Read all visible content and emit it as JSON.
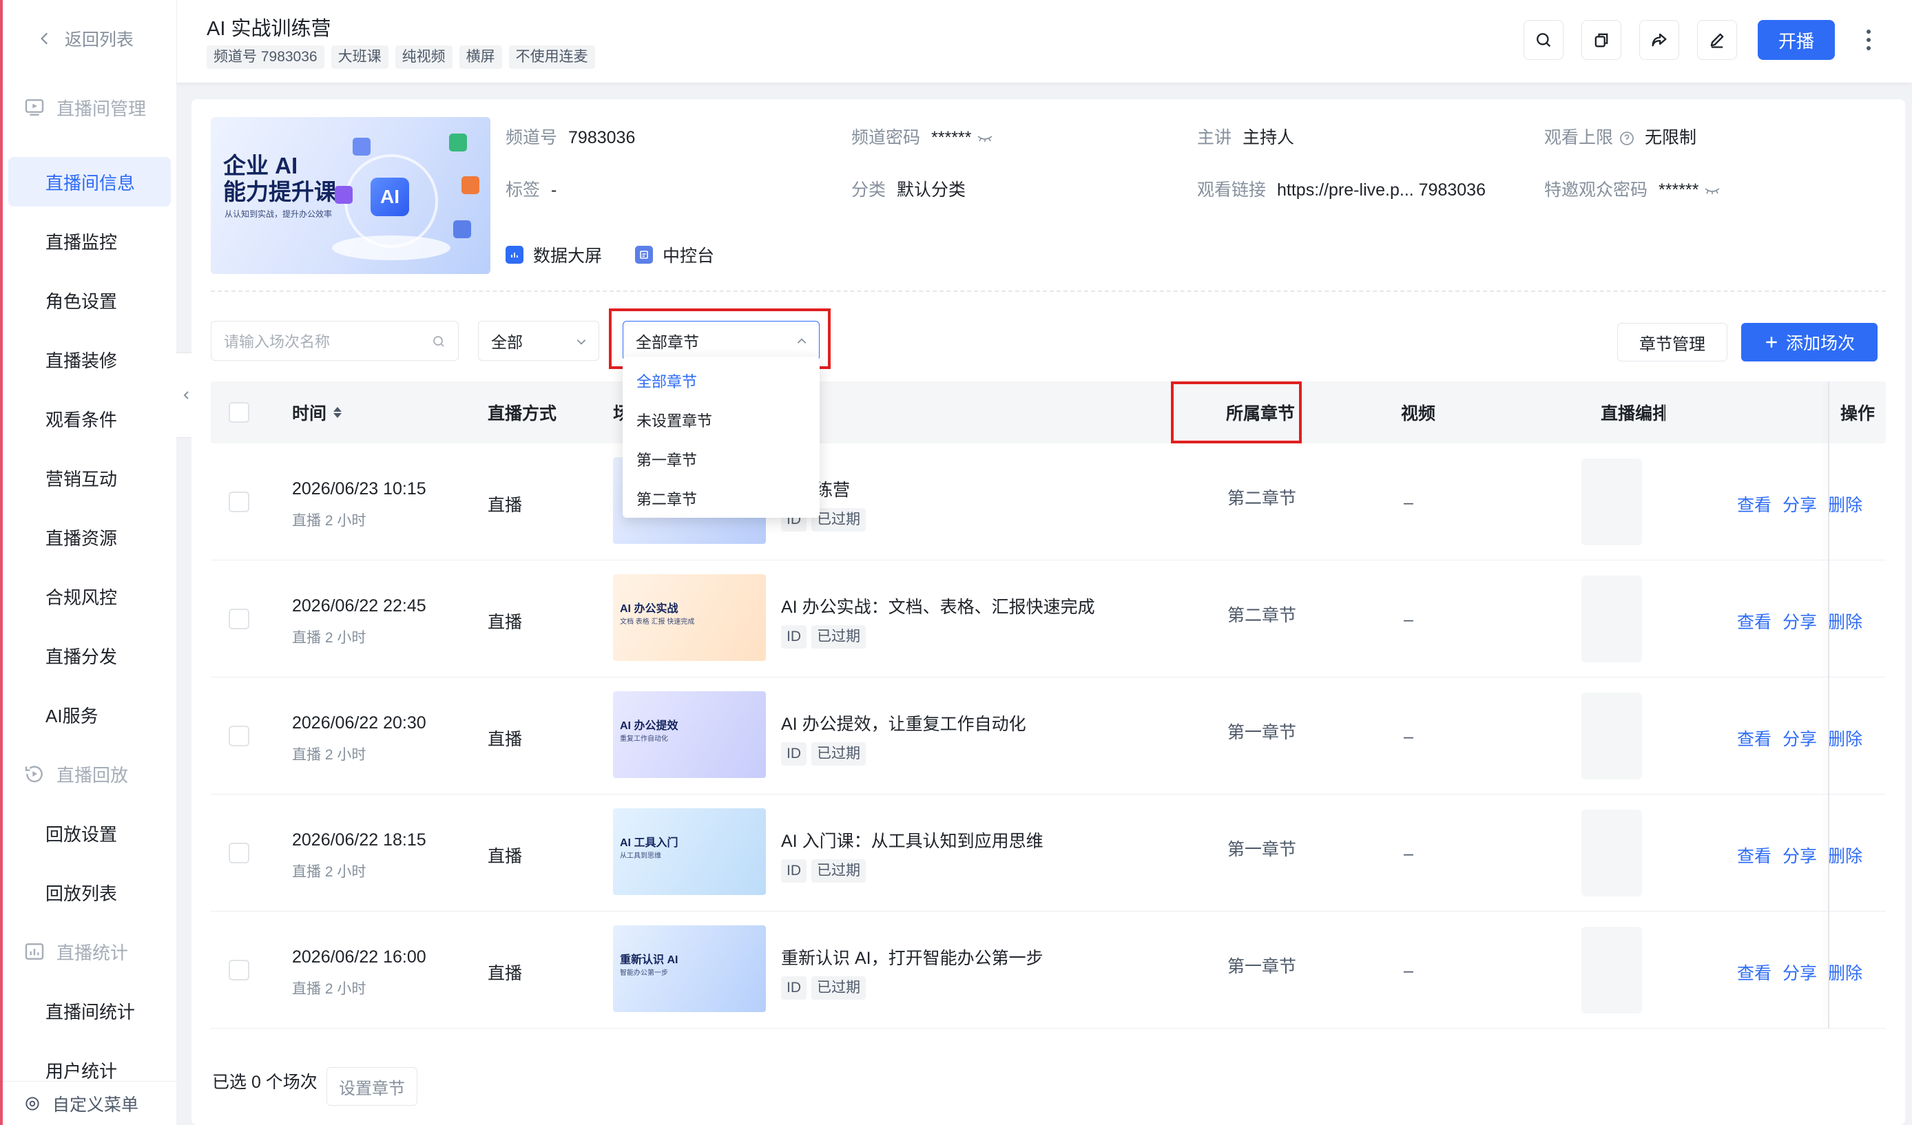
{
  "topbar": {
    "back_label": "返回列表",
    "title": "AI 实战训练营",
    "tags": [
      "频道号 7983036",
      "大班课",
      "纯视频",
      "横屏",
      "不使用连麦"
    ],
    "live_button": "开播"
  },
  "sidebar": {
    "groups": [
      {
        "label": "直播间管理",
        "icon": "screen-play-icon",
        "items": [
          "直播间信息",
          "直播监控",
          "角色设置",
          "直播装修",
          "观看条件",
          "营销互动",
          "直播资源",
          "合规风控",
          "直播分发",
          "AI服务"
        ]
      },
      {
        "label": "直播回放",
        "icon": "replay-icon",
        "items": [
          "回放设置",
          "回放列表"
        ]
      },
      {
        "label": "直播统计",
        "icon": "chart-icon",
        "items": [
          "直播间统计",
          "用户统计"
        ]
      }
    ],
    "active": "直播间信息",
    "custom_menu": "自定义菜单"
  },
  "cover": {
    "title_line1": "企业 AI",
    "title_line2": "能力提升课",
    "subtitle": "从认知到实战，提升办公效率",
    "badge": "AI"
  },
  "channel_info": {
    "channel_no_label": "频道号",
    "channel_no": "7983036",
    "password_label": "频道密码",
    "password": "******",
    "host_label": "主讲",
    "host": "主持人",
    "limit_label": "观看上限",
    "limit": "无限制",
    "tag_label": "标签",
    "tag": "-",
    "category_label": "分类",
    "category": "默认分类",
    "link_label": "观看链接",
    "link": "https://pre-live.p... 7983036",
    "vip_password_label": "特邀观众密码",
    "vip_password": "******",
    "data_screen": "数据大屏",
    "console": "中控台"
  },
  "filters": {
    "search_placeholder": "请输入场次名称",
    "type_value": "全部",
    "chapter_value": "全部章节",
    "chapter_options": [
      "全部章节",
      "未设置章节",
      "第一章节",
      "第二章节"
    ],
    "chapter_manage": "章节管理",
    "add_session": "添加场次"
  },
  "table": {
    "headers": {
      "time": "时间",
      "mode": "直播方式",
      "session": "场",
      "chapter": "所属章节",
      "video": "视频",
      "editor": "直播编排",
      "ops": "操作"
    },
    "rows": [
      {
        "time": "2026/06/23 10:15",
        "duration": "直播 2 小时",
        "mode": "直播",
        "title": "战训练营",
        "id": "ID",
        "status": "已过期",
        "chapter": "第二章节",
        "video": "–",
        "thumb_title": "",
        "thumb_sub": ""
      },
      {
        "time": "2026/06/22 22:45",
        "duration": "直播 2 小时",
        "mode": "直播",
        "title": "AI 办公实战：文档、表格、汇报快速完成",
        "id": "ID",
        "status": "已过期",
        "chapter": "第二章节",
        "video": "–",
        "thumb_title": "AI 办公实战",
        "thumb_sub": "文档 表格 汇报 快速完成"
      },
      {
        "time": "2026/06/22 20:30",
        "duration": "直播 2 小时",
        "mode": "直播",
        "title": "AI 办公提效，让重复工作自动化",
        "id": "ID",
        "status": "已过期",
        "chapter": "第一章节",
        "video": "–",
        "thumb_title": "AI 办公提效",
        "thumb_sub": "重复工作自动化"
      },
      {
        "time": "2026/06/22 18:15",
        "duration": "直播 2 小时",
        "mode": "直播",
        "title": "AI 入门课：从工具认知到应用思维",
        "id": "ID",
        "status": "已过期",
        "chapter": "第一章节",
        "video": "–",
        "thumb_title": "AI 工具入门",
        "thumb_sub": "从工具到思维"
      },
      {
        "time": "2026/06/22 16:00",
        "duration": "直播 2 小时",
        "mode": "直播",
        "title": "重新认识 AI，打开智能办公第一步",
        "id": "ID",
        "status": "已过期",
        "chapter": "第一章节",
        "video": "–",
        "thumb_title": "重新认识 AI",
        "thumb_sub": "智能办公第一步"
      }
    ],
    "row_ops": [
      "查看",
      "分享",
      "删除"
    ]
  },
  "footer": {
    "selected": "已选 0 个场次",
    "set_chapter": "设置章节"
  },
  "colors": {
    "primary": "#2e6cf6",
    "highlight_box": "#e02020",
    "accent_strip": "#e8516a"
  }
}
